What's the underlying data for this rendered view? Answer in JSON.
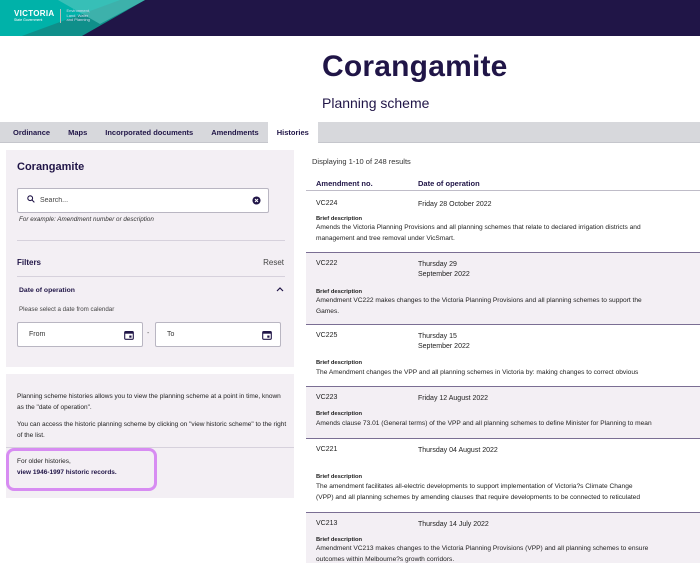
{
  "header": {
    "logo_text": "VICTORIA",
    "logo_sub": "State Government",
    "dept_lines": [
      "Environment,",
      "Land, Water",
      "and Planning"
    ]
  },
  "page": {
    "title": "Corangamite",
    "subtitle": "Planning scheme"
  },
  "tabs": [
    {
      "label": "Ordinance",
      "active": false
    },
    {
      "label": "Maps",
      "active": false
    },
    {
      "label": "Incorporated documents",
      "active": false
    },
    {
      "label": "Amendments",
      "active": false
    },
    {
      "label": "Histories",
      "active": true
    }
  ],
  "search_panel": {
    "title": "Corangamite",
    "search_placeholder": "Search...",
    "hint": "For example: Amendment number or description",
    "filters_label": "Filters",
    "reset_label": "Reset",
    "date_of_operation": "Date of operation",
    "date_hint": "Please select a date from calendar",
    "from_label": "From",
    "to_label": "To",
    "dash": "-"
  },
  "info_panel": {
    "para1": "Planning scheme histories allows you to view the planning scheme at a point in time, known as the \"date of operation\".",
    "para2": "You can access the historic planning scheme by clicking on \"view historic scheme\" to the right of the list.",
    "older_text": "For older histories,",
    "older_link": "view 1946-1997 historic records."
  },
  "results": {
    "count_text": "Displaying 1-10 of 248 results",
    "col_amendment": "Amendment no.",
    "col_date": "Date of operation",
    "brief_label": "Brief description",
    "rows": [
      {
        "amendment": "VC224",
        "date": "Friday 28 October 2022",
        "desc": [
          "Amends the Victoria Planning Provisions and all planning schemes that relate to declared irrigation districts and",
          "management and tree removal under VicSmart."
        ]
      },
      {
        "amendment": "VC222",
        "date": "Thursday 29 September 2022",
        "desc": [
          "Amendment VC222 makes changes to the Victoria Planning Provisions and all planning schemes to support the",
          "Games."
        ]
      },
      {
        "amendment": "VC225",
        "date": "Thursday 15 September 2022",
        "desc": [
          "The Amendment changes the VPP and all planning schemes in Victoria by: making changes to correct obvious"
        ]
      },
      {
        "amendment": "VC223",
        "date": "Friday 12 August 2022",
        "desc": [
          "Amends clause 73.01 (General terms) of the VPP and all planning schemes to define Minister for Planning to mean"
        ]
      },
      {
        "amendment": "VC221",
        "date": "Thursday 04 August 2022",
        "desc": [
          "The amendment facilitates all-electric developments to support implementation of Victoria?s Climate Change",
          "(VPP) and all planning schemes by amending clauses that require developments to be connected to reticulated"
        ]
      },
      {
        "amendment": "VC213",
        "date": "Thursday 14 July 2022",
        "desc": [
          "Amendment VC213 makes changes to the Victoria Planning Provisions (VPP) and all planning schemes to ensure",
          "outcomes within Melbourne?s growth corridors."
        ]
      }
    ]
  },
  "colors": {
    "navy": "#201547",
    "teal": "#00b2a9",
    "panel_bg": "#f3eff4",
    "tabbar_bg": "#d7d8dc",
    "highlight": "#d78cf2"
  }
}
